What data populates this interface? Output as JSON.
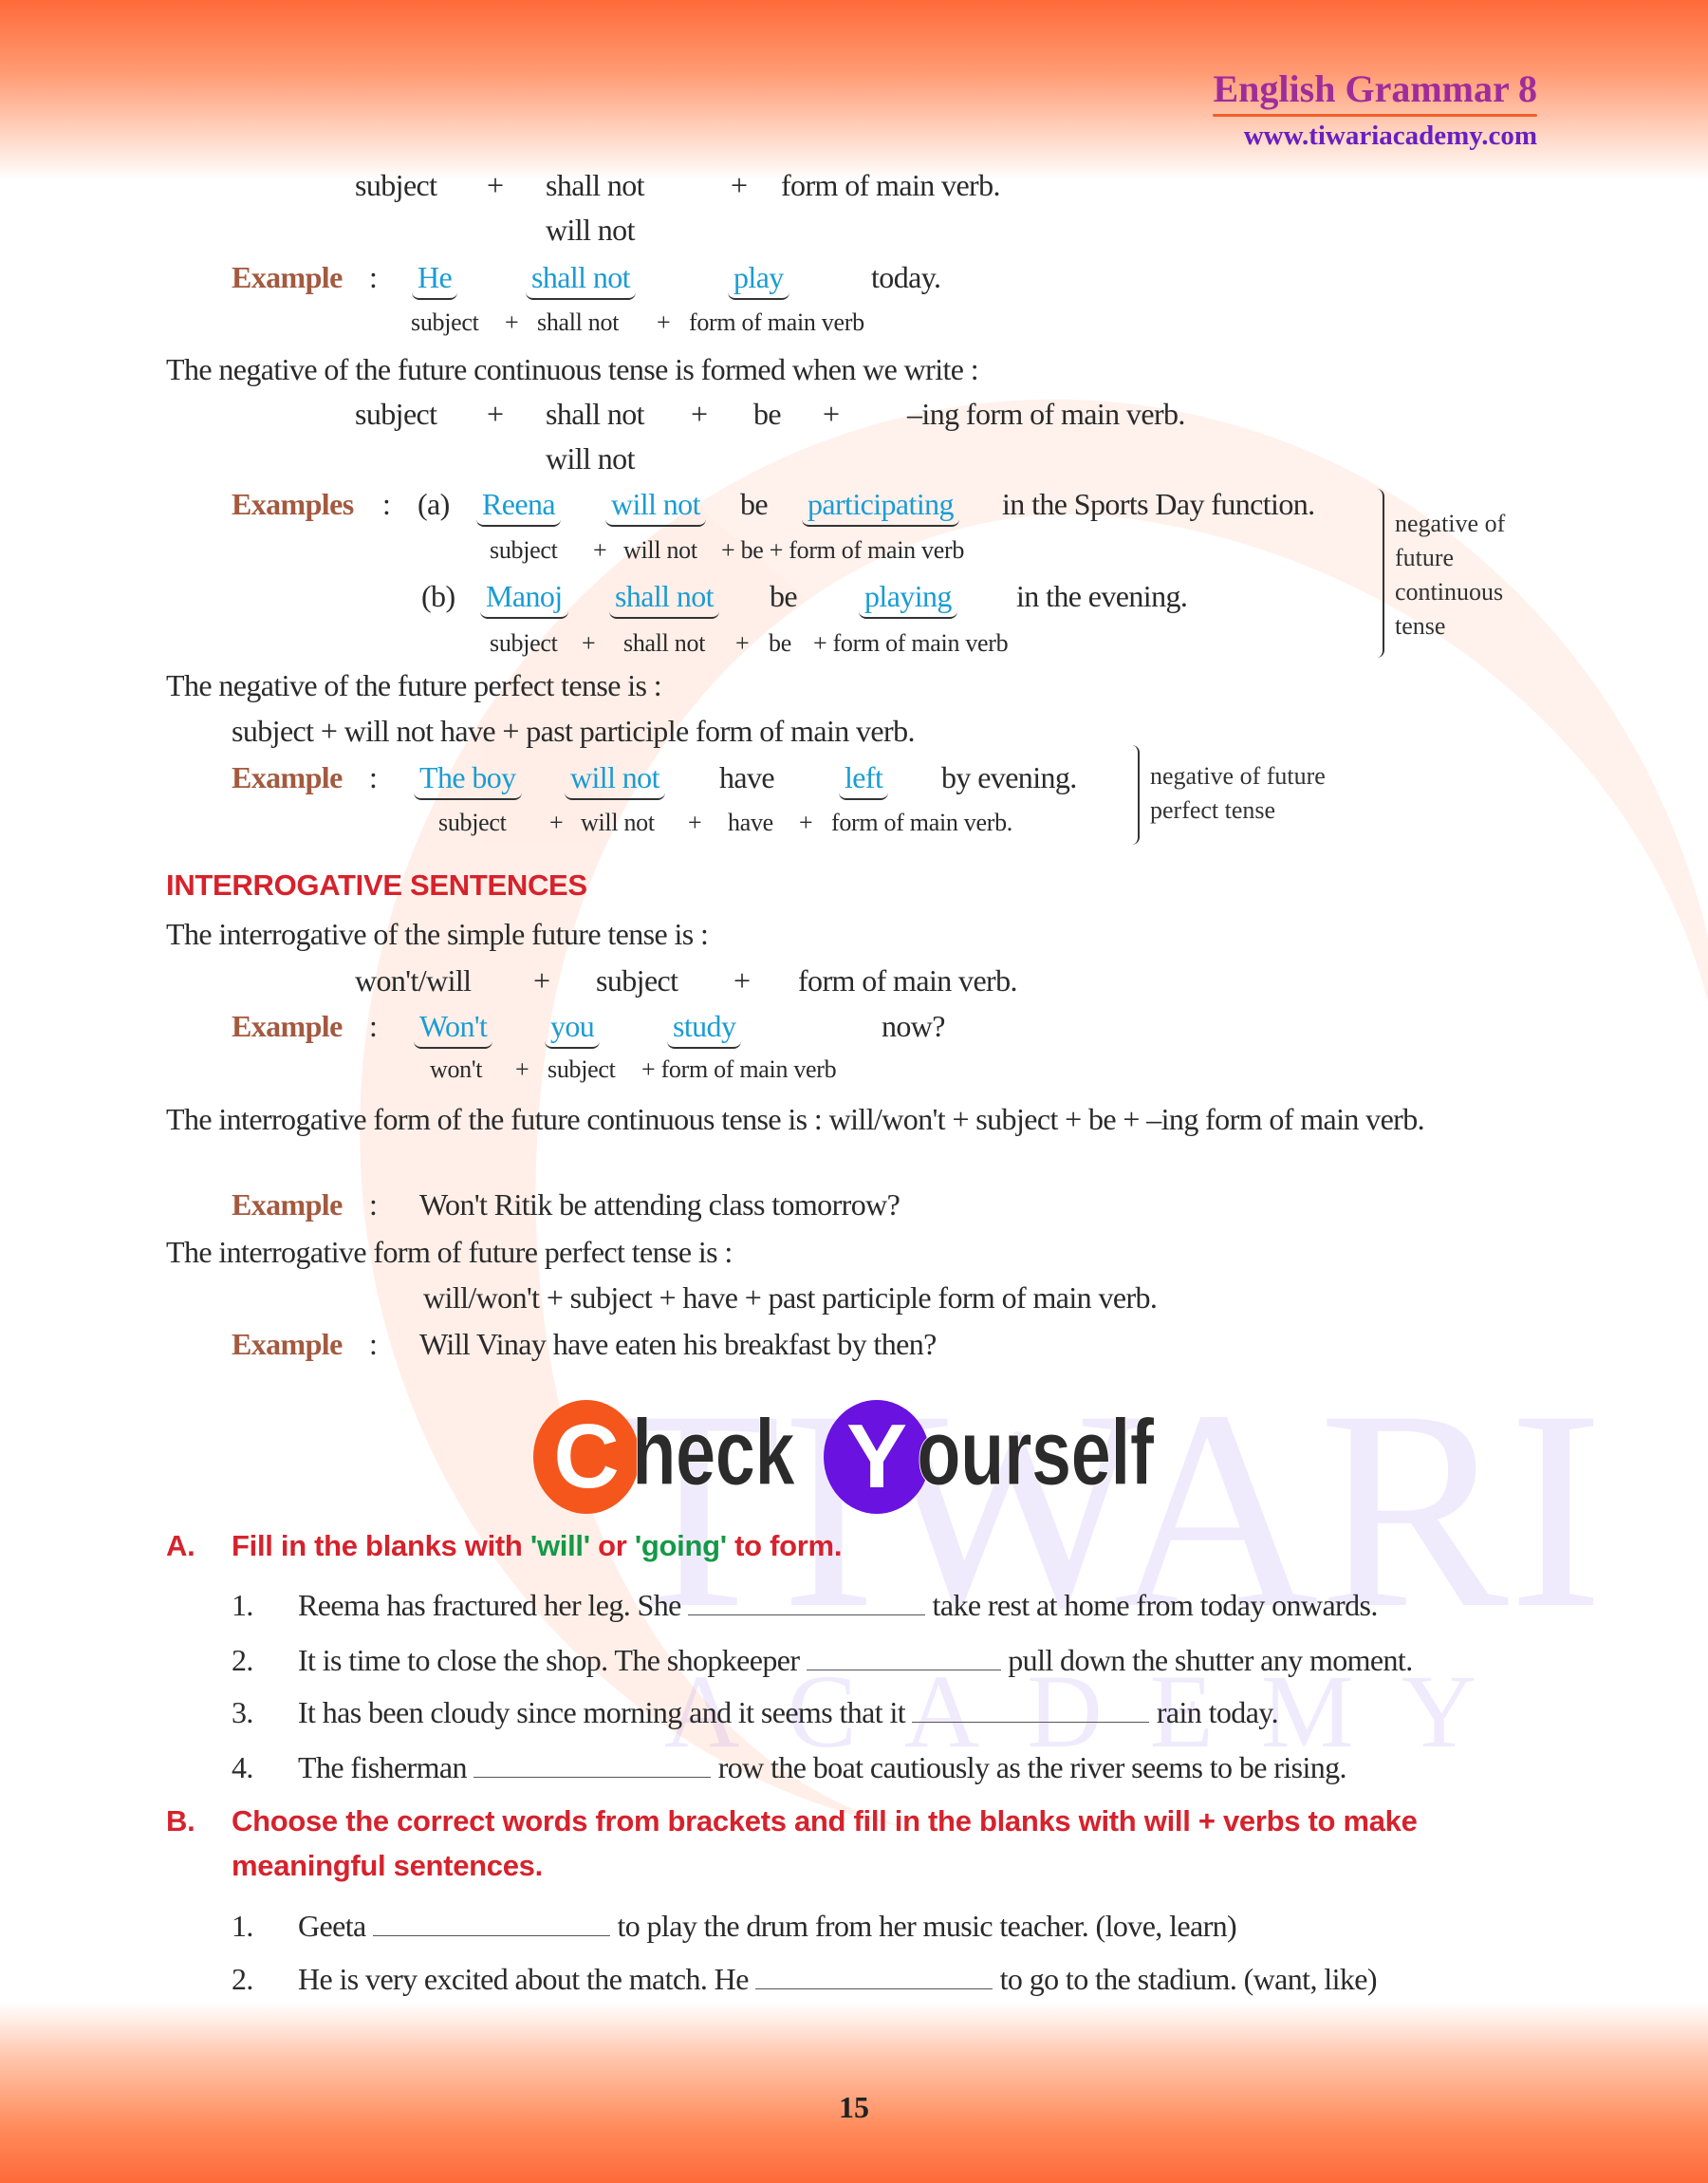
{
  "header": {
    "title": "English Grammar 8",
    "url": "www.tiwariacademy.com",
    "title_color": "#a02c9a",
    "url_color": "#6a1fbf",
    "accent": "#ff6a3a"
  },
  "watermark": {
    "line1": "TIWARI",
    "line2": "ACADEMY"
  },
  "neg_simple": {
    "f_subject": "subject",
    "plus": "+",
    "f_shall": "shall not",
    "f_will": "will not",
    "f_form": "form of main verb.",
    "example_label": "Example",
    "colon": ":",
    "w1": "He",
    "w2": "shall not",
    "w3": "play",
    "w4": "today.",
    "u1": "subject",
    "u2": "shall not",
    "u3": "form of main verb"
  },
  "neg_cont": {
    "intro": "The negative of the future continuous tense is formed when we write :",
    "f_subject": "subject",
    "f_shall": "shall not",
    "f_be": "be",
    "f_ing": "–ing form of main verb.",
    "f_will": "will not",
    "examples_label": "Examples",
    "a": {
      "marker": "(a)",
      "w1": "Reena",
      "w2": "will not",
      "w3": "be",
      "w4": "participating",
      "w5": "in the Sports Day function.",
      "u1": "subject",
      "u2": "will not",
      "u3": "+ be + form of main verb"
    },
    "b": {
      "marker": "(b)",
      "w1": "Manoj",
      "w2": "shall not",
      "w3": "be",
      "w4": "playing",
      "w5": "in the evening.",
      "u1": "subject",
      "u2": "shall not",
      "u3": "be",
      "u4": "+ form of main verb"
    },
    "note": [
      "negative of",
      "future",
      "continuous",
      "tense"
    ]
  },
  "neg_perf": {
    "intro": "The negative of the future perfect tense is :",
    "formula": "subject + will not have + past participle form of main verb.",
    "w1": "The boy",
    "w2": "will not",
    "w3": "have",
    "w4": "left",
    "w5": "by evening.",
    "u1": "subject",
    "u2": "will not",
    "u3": "have",
    "u4": "form of main verb.",
    "note": [
      "negative of future",
      "perfect tense"
    ]
  },
  "interrogative": {
    "heading": "INTERROGATIVE SENTENCES",
    "intro1": "The interrogative of the simple future tense is :",
    "f1": "won't/will",
    "f2": "subject",
    "f3": "form of main verb.",
    "w1": "Won't",
    "w2": "you",
    "w3": "study",
    "w4": "now?",
    "u1": "won't",
    "u2": "subject",
    "u3": "+ form of main verb",
    "intro2": "The interrogative form of the future continuous tense is : will/won't + subject + be + –ing form of main verb.",
    "ex2": "Won't Ritik be attending class tomorrow?",
    "intro3": "The interrogative form of future perfect tense is :",
    "formula3": "will/won't + subject + have + past participle form of main verb.",
    "ex3": "Will Vinay have eaten his breakfast by then?"
  },
  "check_yourself": {
    "c": "C",
    "heck": "heck",
    "y": "Y",
    "ourself": "ourself",
    "c_color": "#f4561c",
    "y_color": "#6a12e0"
  },
  "section_a": {
    "letter": "A.",
    "title_1": "Fill in the blanks with ",
    "will": "'will'",
    "or": " or ",
    "going": "'going'",
    "title_2": " to form.",
    "items": [
      {
        "n": "1.",
        "pre": "Reema has fractured her leg. She",
        "post": "take rest at home from today onwards."
      },
      {
        "n": "2.",
        "pre": "It is time to close the shop. The shopkeeper",
        "post": "pull down the shutter any moment."
      },
      {
        "n": "3.",
        "pre": "It has been cloudy since morning and it seems that it",
        "post": "rain today."
      },
      {
        "n": "4.",
        "pre": "The fisherman",
        "post": "row the boat cautiously as the river seems to be rising."
      }
    ]
  },
  "section_b": {
    "letter": "B.",
    "title_1": "Choose the correct words from brackets and fill in the blanks with will + verbs to make",
    "title_2": "meaningful sentences.",
    "items": [
      {
        "n": "1.",
        "pre": "Geeta",
        "post": "to play the drum from her music teacher. (love, learn)"
      },
      {
        "n": "2.",
        "pre": "He is very excited about the match. He",
        "post": "to go to the stadium. (want, like)"
      }
    ]
  },
  "page_number": "15"
}
